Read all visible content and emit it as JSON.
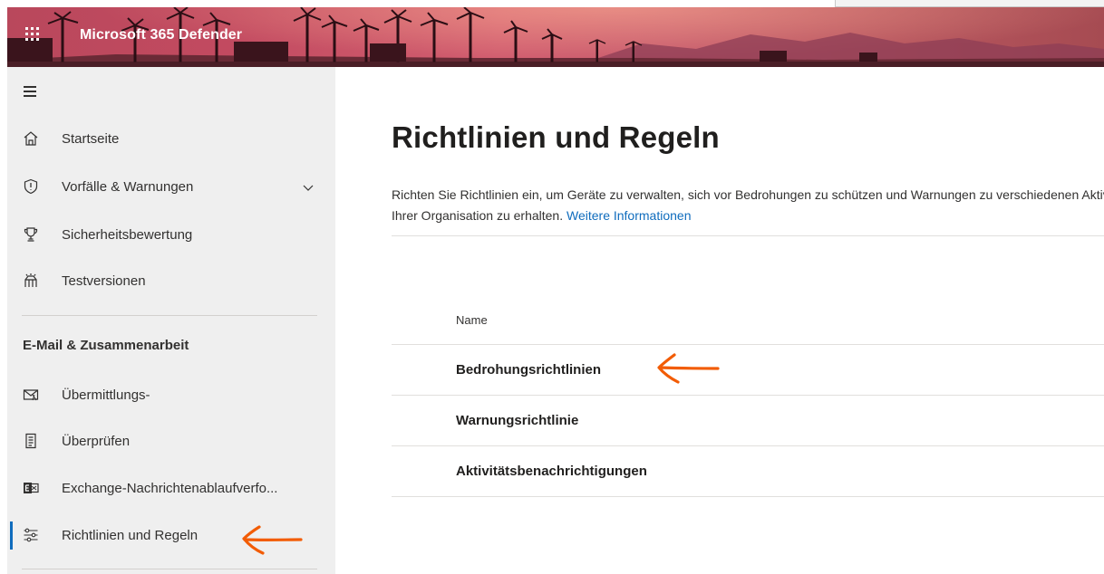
{
  "header": {
    "app_title": "Microsoft 365 Defender",
    "banner_colors": [
      "#b9485c",
      "#d25f70",
      "#a64b52"
    ]
  },
  "sidebar": {
    "menu_icon": "hamburger-icon",
    "items_top": [
      {
        "label": "Startseite",
        "icon": "home-icon"
      },
      {
        "label": "Vorfälle & Warnungen",
        "icon": "shield-icon",
        "expandable": true
      },
      {
        "label": "Sicherheitsbewertung",
        "icon": "trophy-icon"
      },
      {
        "label": "Testversionen",
        "icon": "trials-icon"
      }
    ],
    "section_title": "E-Mail & Zusammenarbeit",
    "items_section": [
      {
        "label": "Übermittlungs-",
        "icon": "mail-submission-icon"
      },
      {
        "label": "Überprüfen",
        "icon": "review-icon"
      },
      {
        "label": "Exchange-Nachrichtenablaufverfo...",
        "icon": "exchange-icon"
      },
      {
        "label": "Richtlinien und Regeln",
        "icon": "sliders-icon",
        "active": true
      }
    ],
    "active_color": "#0f6cbd"
  },
  "main": {
    "title": "Richtlinien und Regeln",
    "description_line1": "Richten Sie Richtlinien ein, um Geräte zu verwalten, sich vor Bedrohungen zu schützen und Warnungen zu verschiedenen Aktivitäten in",
    "description_line2": "Ihrer Organisation zu erhalten.",
    "more_info_link": "Weitere Informationen",
    "table": {
      "column_header": "Name",
      "rows": [
        "Bedrohungsrichtlinien",
        "Warnungsrichtlinie",
        "Aktivitätsbenachrichtigungen"
      ]
    },
    "link_color": "#0f6cbd"
  },
  "annotations": {
    "arrow_color": "#f25c05"
  }
}
